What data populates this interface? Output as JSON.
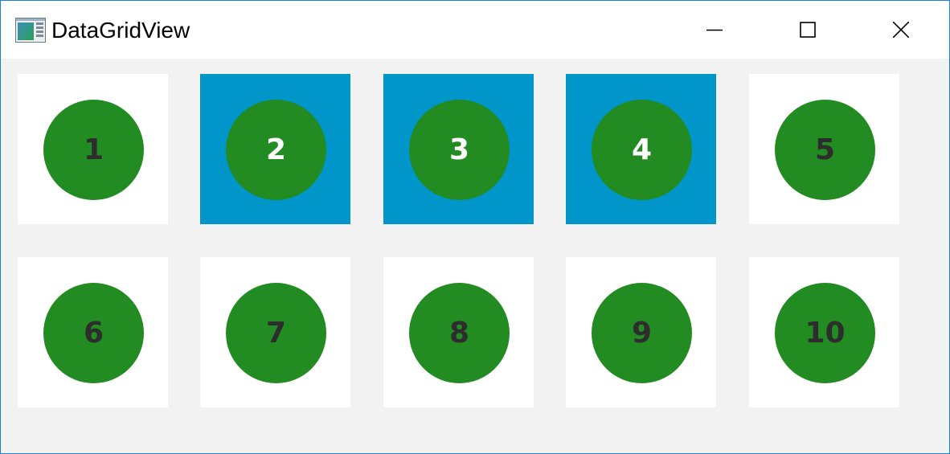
{
  "window": {
    "title": "DataGridView",
    "app_icon": "datagrid-app-icon",
    "border_color": "#1883d7"
  },
  "caption_buttons": [
    {
      "name": "minimize",
      "icon": "minimize-icon"
    },
    {
      "name": "maximize",
      "icon": "maximize-icon"
    },
    {
      "name": "close",
      "icon": "close-icon"
    }
  ],
  "colors": {
    "selected_background": "#0096c9",
    "circle": "#228b22",
    "cell_background": "#ffffff",
    "grid_background": "#f2f2f2"
  },
  "items": [
    {
      "label": "1",
      "selected": false
    },
    {
      "label": "2",
      "selected": true
    },
    {
      "label": "3",
      "selected": true
    },
    {
      "label": "4",
      "selected": true
    },
    {
      "label": "5",
      "selected": false
    },
    {
      "label": "6",
      "selected": false
    },
    {
      "label": "7",
      "selected": false
    },
    {
      "label": "8",
      "selected": false
    },
    {
      "label": "9",
      "selected": false
    },
    {
      "label": "10",
      "selected": false
    }
  ]
}
